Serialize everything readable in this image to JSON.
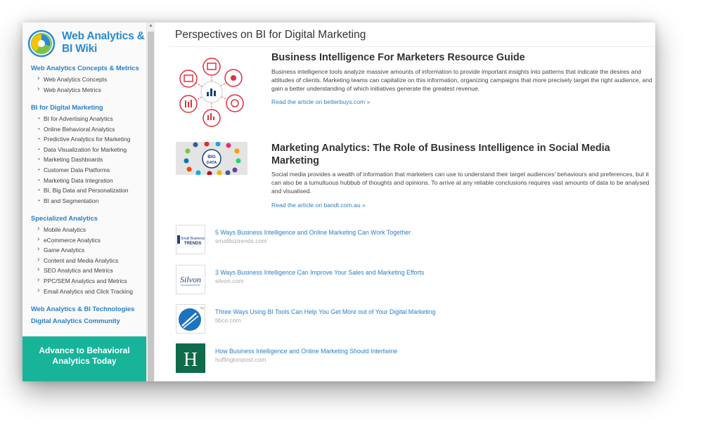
{
  "colors": {
    "accent": "#2a7fc6",
    "cta_bg": "#17b49a",
    "text": "#333333"
  },
  "sidebar": {
    "logo_icon": "pie-chart-logo-icon",
    "logo_title": "Web Analytics & BI Wiki",
    "sections": [
      {
        "title": "Web Analytics Concepts & Metrics",
        "items": [
          "Web Analytics Concepts",
          "Web Analytics Metrics"
        ]
      },
      {
        "title": "BI for Digital Marketing",
        "items": [
          "BI for Advertising Analytics",
          "Online Behavioral Analytics",
          "Predictive Analytics for Marketing",
          "Data Visualization for Marketing",
          "Marketing Dashboards",
          "Customer Data Platforms",
          "Marketing Data Integration",
          "BI, Big Data and Personalization",
          "BI and Segmentation"
        ]
      },
      {
        "title": "Specialized Analytics",
        "items": [
          "Mobile Analytics",
          "eCommerce Analytics",
          "Game Analytics",
          "Content and Media Analytics",
          "SEO Analytics and Metrics",
          "PPC/SEM Analytics and Metrics",
          "Email Analytics and Click Tracking"
        ]
      },
      {
        "title": "Web Analytics & BI Technologies",
        "items": []
      },
      {
        "title": "Digital Analytics Community",
        "items": []
      }
    ],
    "cta": "Advance to Behavioral Analytics Today"
  },
  "main": {
    "page_title": "Perspectives on BI for Digital Marketing",
    "features": [
      {
        "title": "Business Intelligence For Marketers Resource Guide",
        "text": "Business intelligence tools analyze massive amounts of information to provide important insights into patterns that indicate the desires and attitudes of clients. Marketing teams can capitalize on this information, organizing campaigns that more precisely target the right audience, and gain a better understanding of which initiatives generate the greatest revenue.",
        "link": "Read the article on betterbuys.com »",
        "image": "bi-icons-network-image"
      },
      {
        "title": "Marketing Analytics: The Role of Business Intelligence in Social Media Marketing",
        "text": "Social media provides a wealth of information that marketers can use to understand their target audiences' behaviours and preferences, but it can also be a tumultuous hubbub of thoughts and opinions. To arrive at any reliable conclusions requires vast amounts of data to be analysed and visualised.",
        "link": "Read the article on bandt.com.au »",
        "image": "big-data-social-image",
        "image_text": "BIG DATA"
      }
    ],
    "links": [
      {
        "title": "5 Ways Business Intelligence and Online Marketing Can Work Together",
        "source": "smallbiztrends.com",
        "thumb_text": "Small Business TRENDS"
      },
      {
        "title": "3 Ways Business Intelligence Can Improve Your Sales and Marketing Efforts",
        "source": "silvon.com",
        "thumb_text": "Silvon"
      },
      {
        "title": "Three Ways Using BI Tools Can Help You Get More out of Your Digital Marketing",
        "source": "tibco.com",
        "thumb_text": "TM"
      },
      {
        "title": "How Business Intelligence and Online Marketing Should Intertwine",
        "source": "huffingtonpost.com",
        "thumb_text": "H"
      }
    ]
  }
}
